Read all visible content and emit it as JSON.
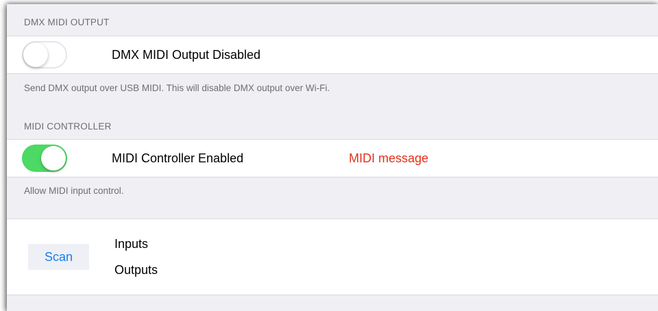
{
  "colors": {
    "background": "#efeff4",
    "toggle_on": "#4cd964",
    "accent_red": "#e0321c",
    "link_blue": "#1a7cf0"
  },
  "dmx_midi_output": {
    "header": "DMX MIDI OUTPUT",
    "toggle_state": "off",
    "label": "DMX MIDI Output Disabled",
    "footer": "Send DMX output over USB MIDI. This will disable DMX output over Wi-Fi."
  },
  "midi_controller": {
    "header": "MIDI CONTROLLER",
    "toggle_state": "on",
    "label": "MIDI Controller Enabled",
    "message": "MIDI message",
    "message_color": "#e0321c",
    "footer": "Allow MIDI input control."
  },
  "ports": {
    "scan_label": "Scan",
    "inputs_label": "Inputs",
    "outputs_label": "Outputs"
  }
}
